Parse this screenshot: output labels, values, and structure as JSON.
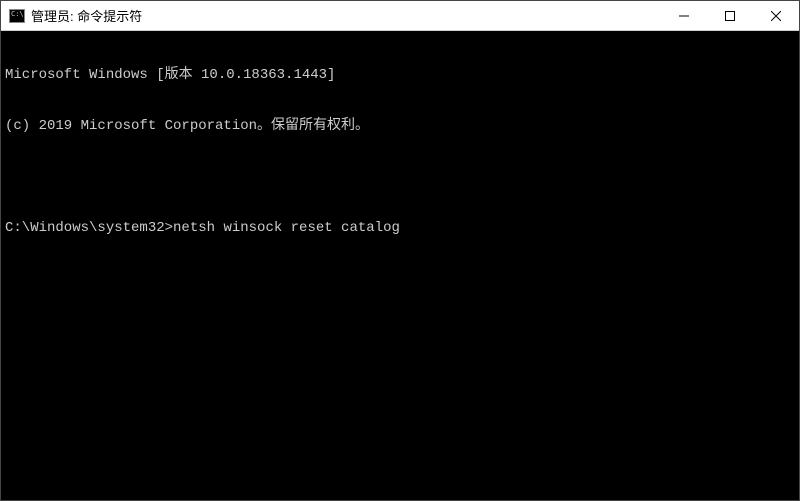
{
  "window": {
    "title": "管理员: 命令提示符"
  },
  "terminal": {
    "line1": "Microsoft Windows [版本 10.0.18363.1443]",
    "line2": "(c) 2019 Microsoft Corporation。保留所有权利。",
    "prompt": "C:\\Windows\\system32>",
    "command": "netsh winsock reset catalog"
  }
}
